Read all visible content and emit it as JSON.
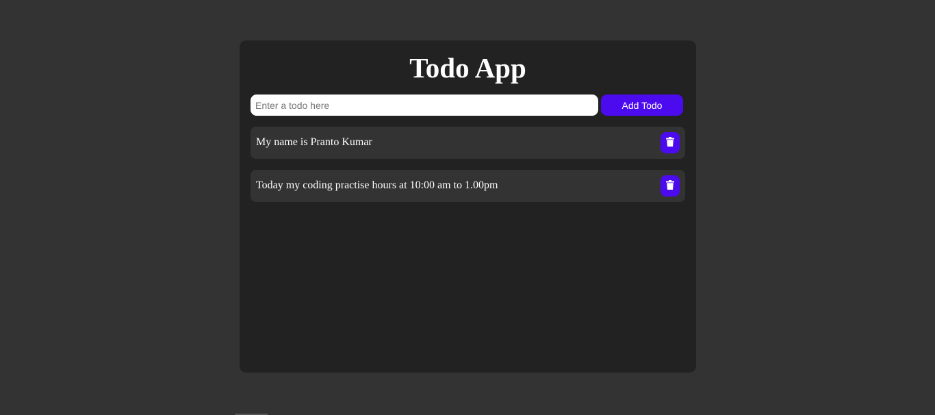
{
  "app": {
    "title": "Todo App"
  },
  "input": {
    "placeholder": "Enter a todo here",
    "value": ""
  },
  "add_button": {
    "label": "Add Todo"
  },
  "todos": [
    {
      "text": "My name is Pranto Kumar",
      "delete_icon": "trash-icon"
    },
    {
      "text": "Today my coding practise hours at 10:00 am to 1.00pm",
      "delete_icon": "trash-icon"
    }
  ],
  "colors": {
    "page_bg": "#333333",
    "card_bg": "#222222",
    "item_bg": "#333333",
    "accent": "#4c0bee",
    "text": "#ffffff"
  }
}
